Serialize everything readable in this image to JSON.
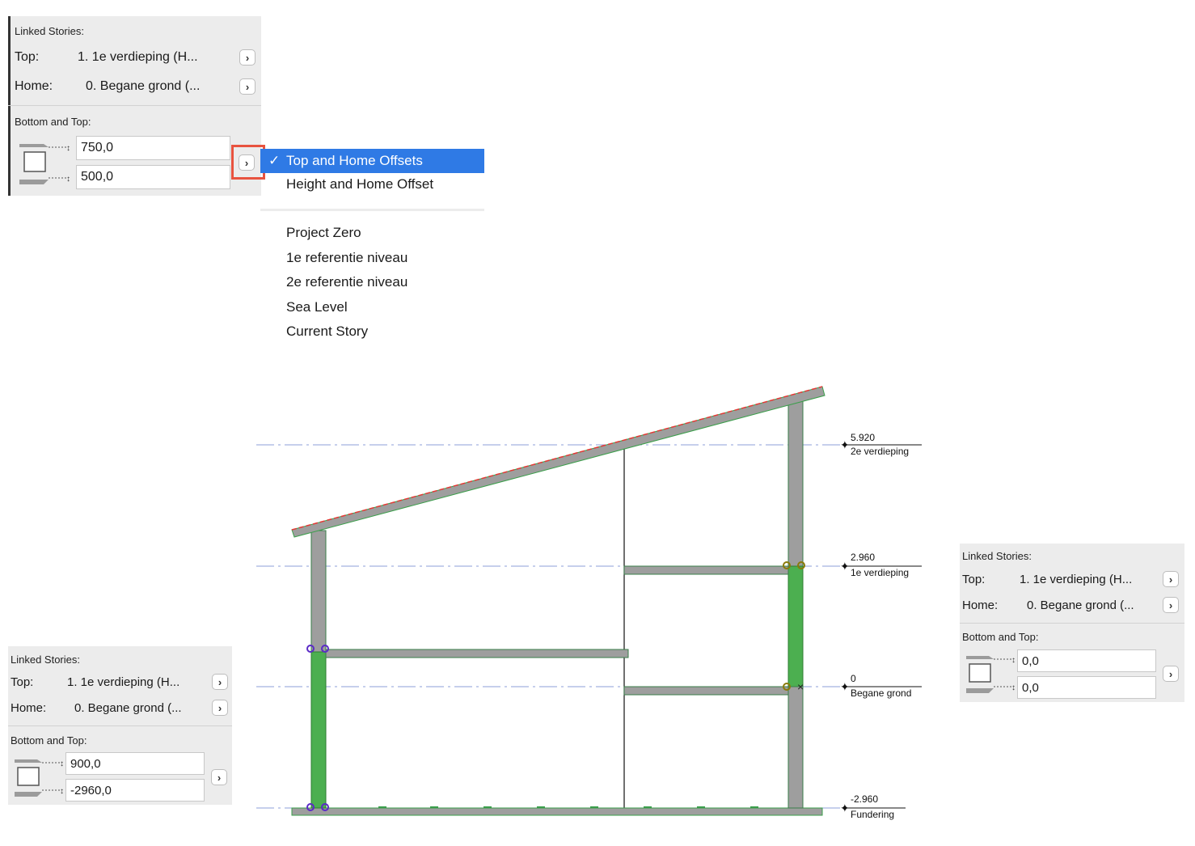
{
  "panel_top_left": {
    "linked_stories_label": "Linked Stories:",
    "top_label": "Top:",
    "top_value": "1. 1e verdieping (H...",
    "home_label": "Home:",
    "home_value": "0. Begane grond (...",
    "bottom_top_label": "Bottom and Top:",
    "top_offset": "750,0",
    "bottom_offset": "500,0"
  },
  "offset_menu": {
    "selected": "Top and Home Offsets",
    "items_group1": [
      "Top and Home Offsets",
      "Height and Home Offset"
    ],
    "items_group2": [
      "Project Zero",
      "1e referentie niveau",
      "2e referentie niveau",
      "Sea Level",
      "Current Story"
    ],
    "checkmark": "✓"
  },
  "panel_bottom_left": {
    "linked_stories_label": "Linked Stories:",
    "top_label": "Top:",
    "top_value": "1. 1e verdieping (H...",
    "home_label": "Home:",
    "home_value": "0. Begane grond (...",
    "bottom_top_label": "Bottom and Top:",
    "top_offset": "900,0",
    "bottom_offset": "-2960,0"
  },
  "panel_right": {
    "linked_stories_label": "Linked Stories:",
    "top_label": "Top:",
    "top_value": "1. 1e verdieping (H...",
    "home_label": "Home:",
    "home_value": "0. Begane grond (...",
    "bottom_top_label": "Bottom and Top:",
    "top_offset": "0,0",
    "bottom_offset": "0,0"
  },
  "section": {
    "levels": [
      {
        "elevation": "5.920",
        "name": "2e verdieping"
      },
      {
        "elevation": "2.960",
        "name": "1e verdieping"
      },
      {
        "elevation": "0",
        "name": "Begane grond"
      },
      {
        "elevation": "-2.960",
        "name": "Fundering"
      }
    ]
  },
  "colors": {
    "menu_highlight": "#2f7ae5",
    "callout": "#e8533f",
    "linked_column": "#4caf50",
    "element_gray": "#9e9e9e",
    "story_line": "#8c9fd9"
  }
}
